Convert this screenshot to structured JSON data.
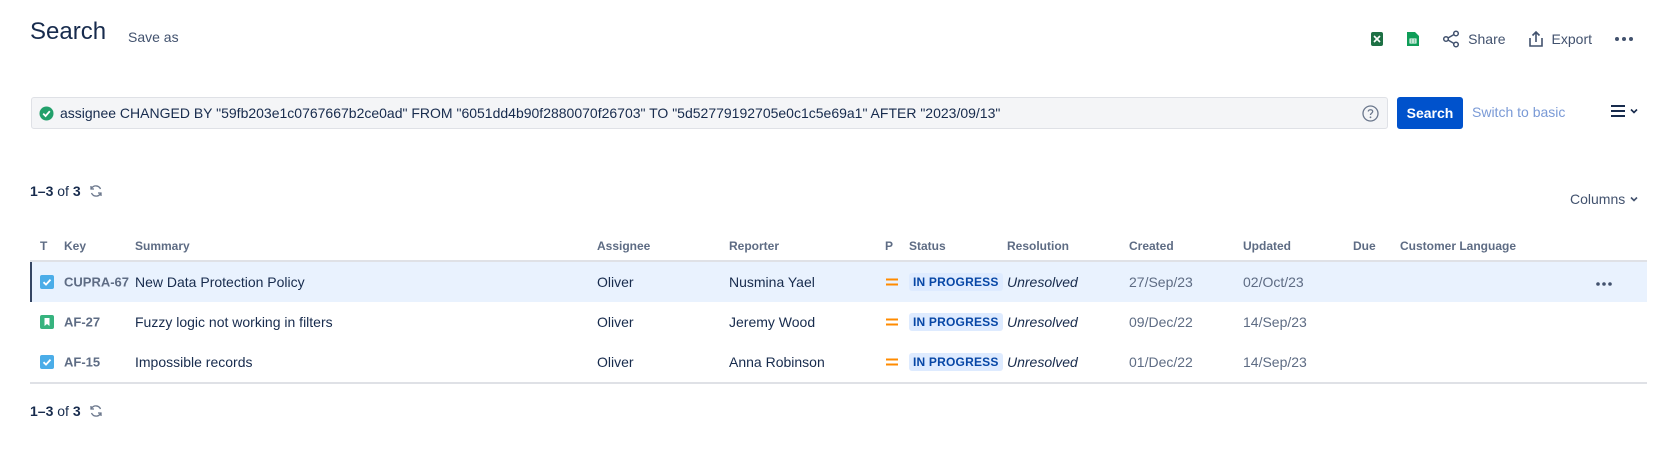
{
  "header": {
    "title": "Search",
    "save_as": "Save as",
    "share": "Share",
    "export": "Export",
    "excel_icon_color": "#1d7044",
    "sheets_icon_color": "#0f9d58"
  },
  "query": {
    "text": "assignee CHANGED BY \"59fb203e1c0767667b2ce0ad\" FROM \"6051dd4b90f2880070f26703\" TO \"5d52779192705e0c1c5e69a1\" AFTER \"2023/09/13\"",
    "search_label": "Search",
    "switch_label": "Switch to basic"
  },
  "results": {
    "range": "1–3",
    "of": "of",
    "total": "3"
  },
  "columns_label": "Columns",
  "table": {
    "headers": {
      "type": "T",
      "key": "Key",
      "summary": "Summary",
      "assignee": "Assignee",
      "reporter": "Reporter",
      "priority": "P",
      "status": "Status",
      "resolution": "Resolution",
      "created": "Created",
      "updated": "Updated",
      "due": "Due",
      "customer_language": "Customer Language"
    },
    "rows": [
      {
        "type": "task",
        "key": "CUPRA-67",
        "summary": "New Data Protection Policy",
        "assignee": "Oliver",
        "reporter": "Nusmina Yael",
        "priority": "medium",
        "status": "IN PROGRESS",
        "resolution": "Unresolved",
        "created": "27/Sep/23",
        "updated": "02/Oct/23",
        "due": "",
        "customer_language": ""
      },
      {
        "type": "story",
        "key": "AF-27",
        "summary": "Fuzzy logic not working in filters",
        "assignee": "Oliver",
        "reporter": "Jeremy Wood",
        "priority": "medium",
        "status": "IN PROGRESS",
        "resolution": "Unresolved",
        "created": "09/Dec/22",
        "updated": "14/Sep/23",
        "due": "",
        "customer_language": ""
      },
      {
        "type": "task",
        "key": "AF-15",
        "summary": "Impossible records",
        "assignee": "Oliver",
        "reporter": "Anna Robinson",
        "priority": "medium",
        "status": "IN PROGRESS",
        "resolution": "Unresolved",
        "created": "01/Dec/22",
        "updated": "14/Sep/23",
        "due": "",
        "customer_language": ""
      }
    ]
  },
  "colors": {
    "primary": "#0052cc",
    "status_bg": "#deebff",
    "status_text": "#0747a6",
    "selected_row": "#e9f2fe",
    "priority_medium": "#ff8b00",
    "task_icon": "#4bade8",
    "story_icon": "#36b37e",
    "valid_icon": "#22a06b"
  }
}
